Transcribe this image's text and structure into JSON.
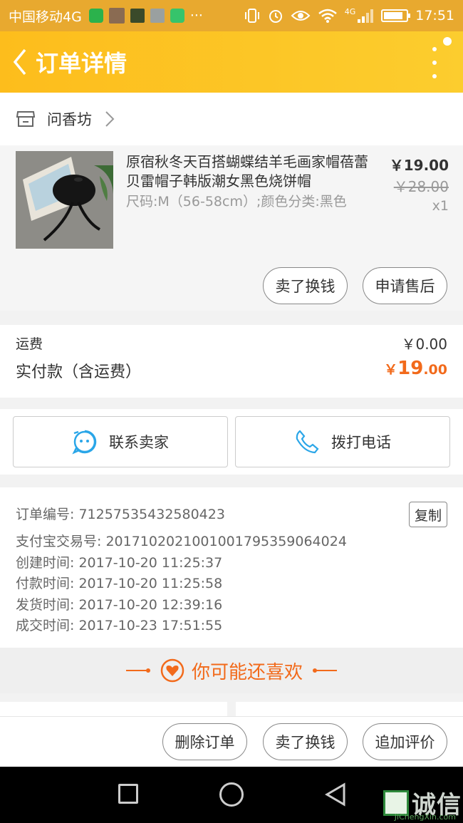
{
  "status_bar": {
    "carrier": "中国移动4G",
    "ellipsis": "···",
    "network": "4G",
    "time": "17:51"
  },
  "header": {
    "title": "订单详情"
  },
  "shop": {
    "name": "问香坊"
  },
  "product": {
    "title": "原宿秋冬天百搭蝴蝶结羊毛画家帽蓓蕾贝雷帽子韩版潮女黑色烧饼帽",
    "spec": "尺码:M（56-58cm）;颜色分类:黑色",
    "price": "￥19.00",
    "original_price": "￥28.00",
    "quantity": "x1",
    "exchange_label": "卖了换钱",
    "after_sale_label": "申请售后"
  },
  "summary": {
    "shipping_label": "运费",
    "shipping_value": "￥0.00",
    "total_label": "实付款（含运费）",
    "total_currency": "￥",
    "total_integer": "19",
    "total_decimal": ".00"
  },
  "contact": {
    "seller_label": "联系卖家",
    "phone_label": "拨打电话"
  },
  "order_info": {
    "order_number": "订单编号: 71257535432580423",
    "copy_label": "复制",
    "alipay_number": "支付宝交易号: 2017102021001001795359064024",
    "created": "创建时间: 2017-10-20 11:25:37",
    "paid": "付款时间: 2017-10-20 11:25:58",
    "shipped": "发货时间: 2017-10-20 12:39:16",
    "completed": "成交时间: 2017-10-23 17:51:55"
  },
  "recommend": {
    "title": "你可能还喜欢"
  },
  "actions": {
    "delete_label": "删除订单",
    "exchange_label": "卖了换钱",
    "review_label": "追加评价"
  },
  "watermark": {
    "text": "诚信",
    "sub": "JiChengXin.com"
  },
  "colors": {
    "brand": "#fdbd1c",
    "accent": "#f26a1b",
    "contact_icon": "#2aa6e8"
  }
}
